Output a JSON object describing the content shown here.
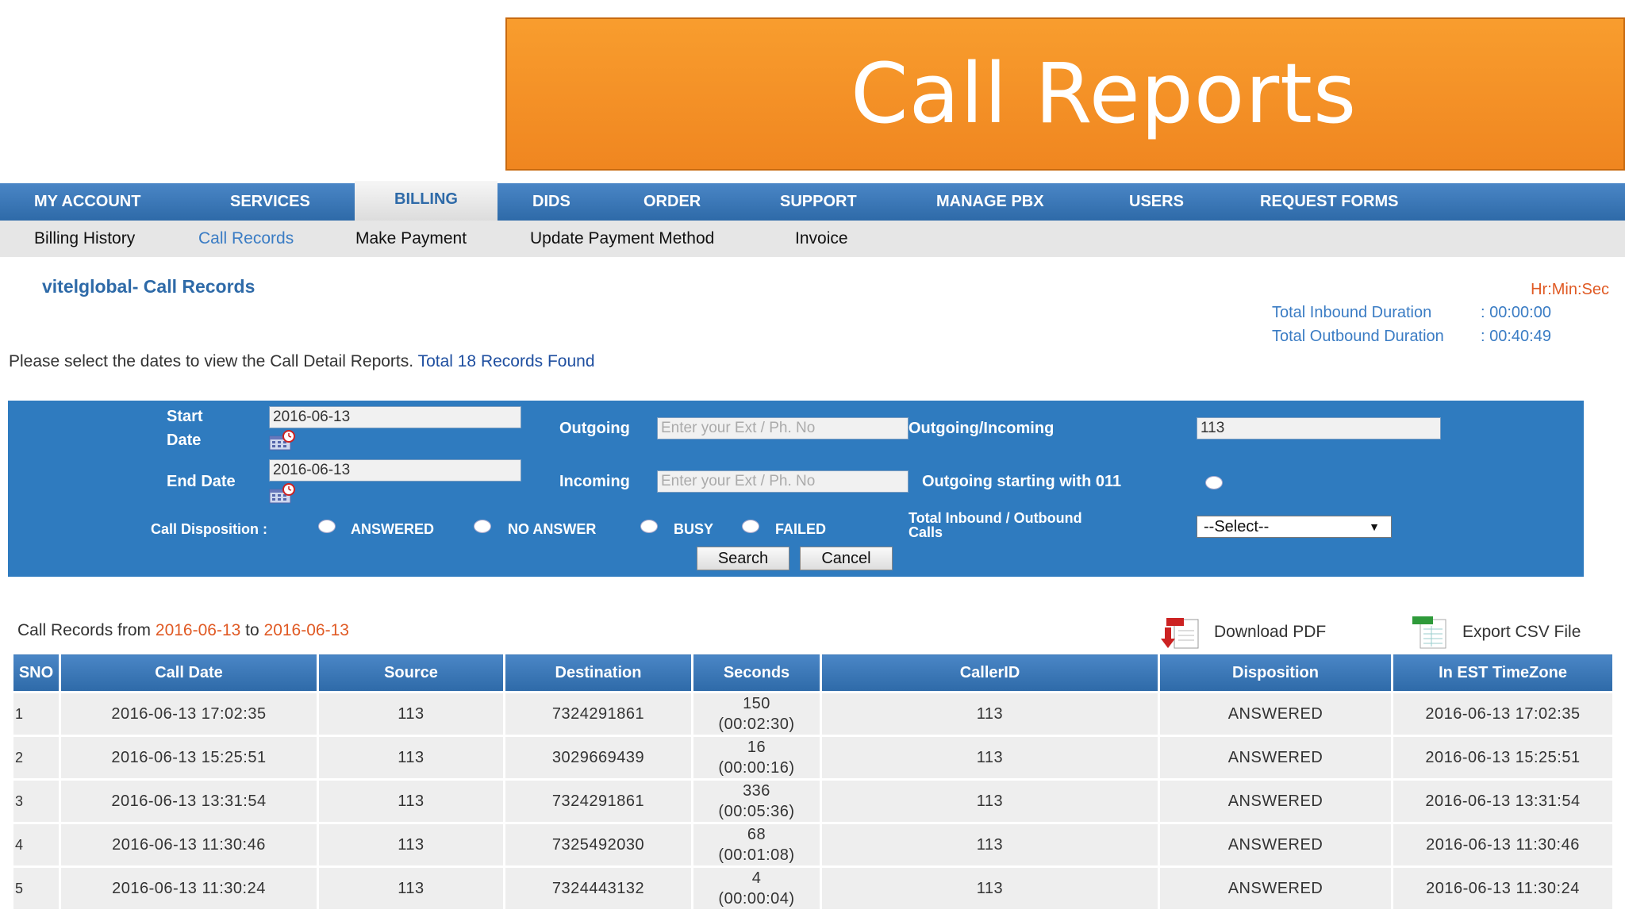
{
  "banner": {
    "title": "Call Reports"
  },
  "topnav": [
    "MY ACCOUNT",
    "SERVICES",
    "BILLING",
    "DIDS",
    "ORDER",
    "SUPPORT",
    "MANAGE PBX",
    "USERS",
    "REQUEST FORMS"
  ],
  "subnav": [
    "Billing History",
    "Call Records",
    "Make Payment",
    "Update Payment Method",
    "Invoice"
  ],
  "page": {
    "title": "vitelglobal- Call Records",
    "units": "Hr:Min:Sec",
    "inbound_label": "Total Inbound Duration",
    "inbound_value": ": 00:00:00",
    "outbound_label": "Total Outbound Duration",
    "outbound_value": ": 00:40:49",
    "intro": "Please select the dates to view the Call Detail Reports.",
    "found": "Total 18 Records Found"
  },
  "filter": {
    "start_label_1": "Start",
    "start_label_2": "Date",
    "start_value": "2016-06-13",
    "end_label": "End Date",
    "end_value": "2016-06-13",
    "outgoing_label": "Outgoing",
    "outgoing_placeholder": "Enter your Ext / Ph. No",
    "incoming_label": "Incoming",
    "incoming_placeholder": "Enter your Ext / Ph. No",
    "out_in_label": "Outgoing/Incoming",
    "out_in_value": "113",
    "starting_011_label": "Outgoing starting with 011",
    "disposition_label": "Call Disposition :",
    "dispositions": [
      "ANSWERED",
      "NO ANSWER",
      "BUSY",
      "FAILED"
    ],
    "total_label_1": "Total Inbound / Outbound",
    "total_label_2": "Calls",
    "select_value": "--Select--",
    "search_label": "Search",
    "cancel_label": "Cancel"
  },
  "records": {
    "range_prefix": "Call Records from",
    "range_from": "2016-06-13",
    "range_mid": "to",
    "range_to": "2016-06-13",
    "download_pdf": "Download PDF",
    "export_csv": "Export CSV File",
    "columns": [
      "SNO",
      "Call Date",
      "Source",
      "Destination",
      "Seconds",
      "CallerID",
      "Disposition",
      "In EST TimeZone"
    ],
    "rows": [
      [
        "1",
        "2016-06-13 17:02:35",
        "113",
        "7324291861",
        "150",
        "(00:02:30)",
        "113",
        "ANSWERED",
        "2016-06-13 17:02:35"
      ],
      [
        "2",
        "2016-06-13 15:25:51",
        "113",
        "3029669439",
        "16",
        "(00:00:16)",
        "113",
        "ANSWERED",
        "2016-06-13 15:25:51"
      ],
      [
        "3",
        "2016-06-13 13:31:54",
        "113",
        "7324291861",
        "336",
        "(00:05:36)",
        "113",
        "ANSWERED",
        "2016-06-13 13:31:54"
      ],
      [
        "4",
        "2016-06-13 11:30:46",
        "113",
        "7325492030",
        "68",
        "(00:01:08)",
        "113",
        "ANSWERED",
        "2016-06-13 11:30:46"
      ],
      [
        "5",
        "2016-06-13 11:30:24",
        "113",
        "7324443132",
        "4",
        "(00:00:04)",
        "113",
        "ANSWERED",
        "2016-06-13 11:30:24"
      ]
    ]
  },
  "colors": {
    "banner": "#f08620",
    "nav_blue": "#2e6aa8",
    "filter_blue": "#2f7bbf",
    "accent_orange": "#e05a24"
  }
}
